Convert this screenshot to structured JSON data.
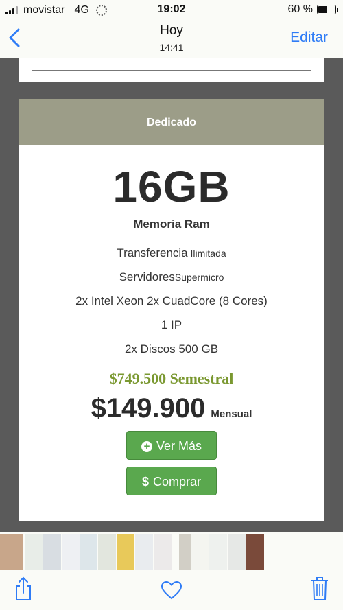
{
  "status_bar": {
    "carrier": "movistar",
    "network": "4G",
    "time": "19:02",
    "battery_text": "60 %",
    "battery_level": 0.6
  },
  "nav": {
    "title": "Hoy",
    "subtitle": "14:41",
    "edit_label": "Editar"
  },
  "plan": {
    "header": "Dedicado",
    "ram": "16GB",
    "ram_label": "Memoria Ram",
    "features": [
      {
        "main": "Transferencia",
        "small": " Ilimitada"
      },
      {
        "main": "Servidores",
        "small": "Supermicro"
      },
      {
        "main": "2x Intel Xeon 2x CuadCore (8 Cores)",
        "small": ""
      },
      {
        "main": "1 IP",
        "small": ""
      },
      {
        "main": "2x Discos 500 GB",
        "small": ""
      }
    ],
    "semester_price": "$749.500 Semestral",
    "monthly_price": "$149.900",
    "monthly_unit": "Mensual",
    "btn_more": "Ver Más",
    "btn_buy": "Comprar",
    "btn_color": "#5aa84e",
    "semester_color": "#7a9830"
  },
  "thumbnails": [
    {
      "icon": "photo-thumbnail",
      "color": "#c8a68a"
    },
    {
      "icon": "photo-thumbnail",
      "color": "#e8ede8"
    },
    {
      "icon": "photo-thumbnail",
      "color": "#d8dde2"
    },
    {
      "icon": "photo-thumbnail",
      "color": "#eef0f3"
    },
    {
      "icon": "photo-thumbnail",
      "color": "#dde6ea"
    },
    {
      "icon": "photo-thumbnail",
      "color": "#e2e6de"
    },
    {
      "icon": "photo-thumbnail",
      "color": "#e8c95a"
    },
    {
      "icon": "photo-thumbnail",
      "color": "#e9ecef"
    },
    {
      "icon": "photo-thumbnail",
      "color": "#eceaea"
    },
    {
      "icon": "photo-thumbnail",
      "color": "#d2cfc6"
    },
    {
      "icon": "photo-thumbnail",
      "color": "#f4f5f0"
    },
    {
      "icon": "photo-thumbnail",
      "color": "#eef1ee"
    },
    {
      "icon": "photo-thumbnail",
      "color": "#e6e8e6"
    },
    {
      "icon": "photo-thumbnail",
      "color": "#7a4a3a"
    },
    {
      "icon": "photo-thumbnail",
      "color": "#b6bcc8"
    },
    {
      "icon": "photo-thumbnail",
      "color": "#3a3230"
    }
  ],
  "toolbar": {
    "share_icon": "share-icon",
    "like_icon": "heart-icon",
    "delete_icon": "trash-icon",
    "accent": "#2f7cf6"
  }
}
